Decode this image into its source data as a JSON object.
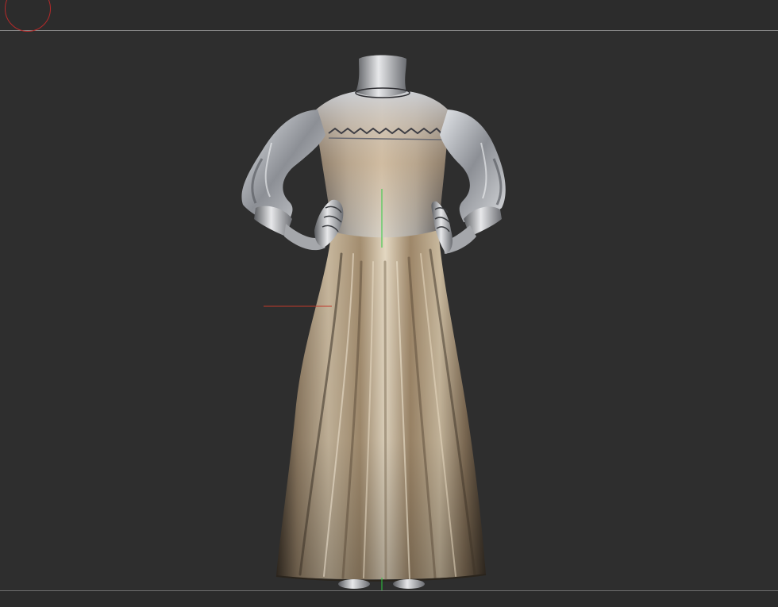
{
  "app": {
    "view": "3d-viewport"
  },
  "viewport": {
    "background_color": "#2e2e2e",
    "separator_color": "#8a8a8a"
  },
  "gizmo": {
    "icon": "orientation-gizmo-icon",
    "color": "#b52a2a"
  },
  "axes": {
    "x_color": "#c0392b",
    "y_color": "#2ecc40"
  },
  "model": {
    "icon": "dress-mesh-icon",
    "material_highlight": "#d8cbb5",
    "material_shadow": "#3b3226"
  }
}
